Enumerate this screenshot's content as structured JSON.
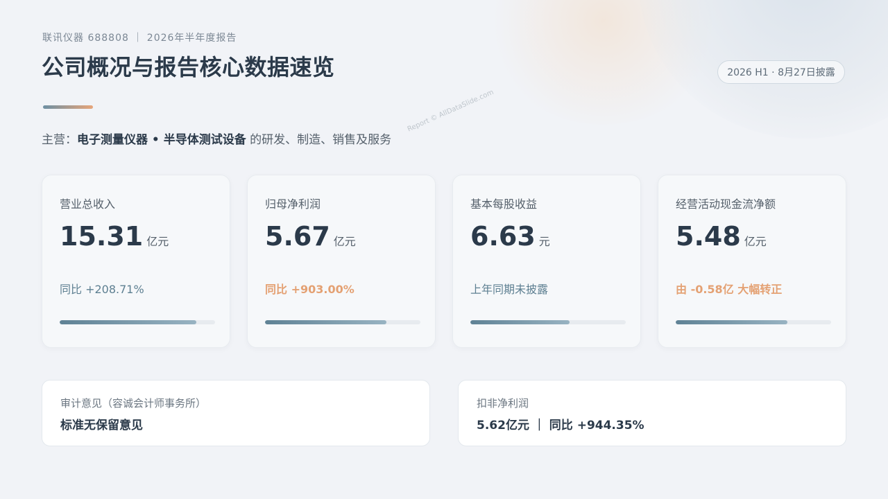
{
  "header": {
    "subtitle": "联讯仪器 688808 ｜ 2026年半年度报告",
    "title": "公司概况与报告核心数据速览",
    "badge": "2026 H1 · 8月27日披露"
  },
  "business": {
    "prefix": "主营：",
    "highlight": "电子测量仪器 • 半导体测试设备",
    "suffix": " 的研发、制造、销售及服务"
  },
  "watermark": "Report © AllDataSlide.com",
  "metrics": [
    {
      "label": "营业总收入",
      "value": "15.31",
      "unit": "亿元",
      "note": "同比 +208.71%",
      "note_style": "normal",
      "progress": 0.88
    },
    {
      "label": "归母净利润",
      "value": "5.67",
      "unit": "亿元",
      "note": "同比 +903.00%",
      "note_style": "orange",
      "progress": 0.78
    },
    {
      "label": "基本每股收益",
      "value": "6.63",
      "unit": "元",
      "note": "上年同期未披露",
      "note_style": "normal",
      "progress": 0.64
    },
    {
      "label": "经营活动现金流净额",
      "value": "5.48",
      "unit": "亿元",
      "note": "由 -0.58亿 大幅转正",
      "note_style": "orange",
      "progress": 0.72
    }
  ],
  "audit": {
    "label": "审计意见（容诚会计师事务所）",
    "value": "标准无保留意见"
  },
  "deducted": {
    "label": "扣非净利润",
    "value": "5.62亿元 ｜ 同比 +944.35%"
  },
  "colors": {
    "accent_orange": "#e4a173",
    "accent_teal": "#5f8295",
    "title": "#2b3a4a"
  }
}
